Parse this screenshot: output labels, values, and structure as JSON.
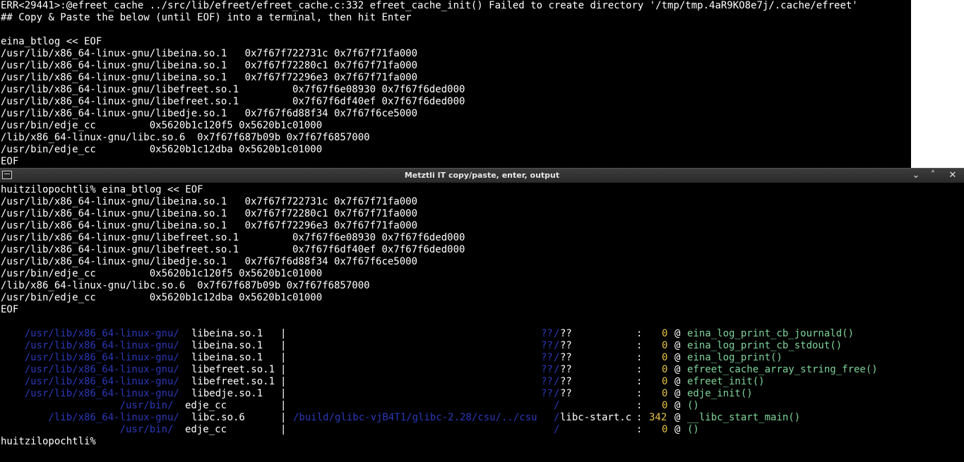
{
  "background_terminal": {
    "lines": [
      "ERR<29441>:@efreet_cache ../src/lib/efreet/efreet_cache.c:332 efreet_cache_init() Failed to create directory '/tmp/tmp.4aR9KO8e7j/.cache/efreet'",
      "## Copy & Paste the below (until EOF) into a terminal, then hit Enter",
      "",
      "eina_btlog << EOF",
      "/usr/lib/x86_64-linux-gnu/libeina.so.1   0x7f67f722731c 0x7f67f71fa000",
      "/usr/lib/x86_64-linux-gnu/libeina.so.1   0x7f67f72280c1 0x7f67f71fa000",
      "/usr/lib/x86_64-linux-gnu/libeina.so.1   0x7f67f72296e3 0x7f67f71fa000",
      "/usr/lib/x86_64-linux-gnu/libefreet.so.1         0x7f67f6e08930 0x7f67f6ded000",
      "/usr/lib/x86_64-linux-gnu/libefreet.so.1         0x7f67f6df40ef 0x7f67f6ded000",
      "/usr/lib/x86_64-linux-gnu/libedje.so.1   0x7f67f6d88f34 0x7f67f6ce5000",
      "/usr/bin/edje_cc         0x5620b1c120f5 0x5620b1c01000",
      "/lib/x86_64-linux-gnu/libc.so.6  0x7f67f687b09b 0x7f67f6857000",
      "/usr/bin/edje_cc         0x5620b1c12dba 0x5620b1c01000",
      "EOF"
    ]
  },
  "window": {
    "title": "Metztli IT copy/paste, enter, output",
    "minimize_glyph": "⌄",
    "maximize_glyph": "˄",
    "close_glyph": "✕"
  },
  "foreground_terminal": {
    "lines": [
      "huitzilopochtli% eina_btlog << EOF",
      "/usr/lib/x86_64-linux-gnu/libeina.so.1   0x7f67f722731c 0x7f67f71fa000",
      "/usr/lib/x86_64-linux-gnu/libeina.so.1   0x7f67f72280c1 0x7f67f71fa000",
      "/usr/lib/x86_64-linux-gnu/libeina.so.1   0x7f67f72296e3 0x7f67f71fa000",
      "/usr/lib/x86_64-linux-gnu/libefreet.so.1         0x7f67f6e08930 0x7f67f6ded000",
      "/usr/lib/x86_64-linux-gnu/libefreet.so.1         0x7f67f6df40ef 0x7f67f6ded000",
      "/usr/lib/x86_64-linux-gnu/libedje.so.1   0x7f67f6d88f34 0x7f67f6ce5000",
      "/usr/bin/edje_cc         0x5620b1c120f5 0x5620b1c01000",
      "/lib/x86_64-linux-gnu/libc.so.6  0x7f67f687b09b 0x7f67f6857000",
      "/usr/bin/edje_cc         0x5620b1c12dba 0x5620b1c01000",
      "EOF"
    ],
    "btlog": [
      {
        "dir": "    /usr/lib/x86_64-linux-gnu/",
        "lib": "libeina.so.1  ",
        "src_dir": "??",
        "src_sep": "/",
        "src_file": "??",
        "line": "0",
        "func": "eina_log_print_cb_journald()"
      },
      {
        "dir": "    /usr/lib/x86_64-linux-gnu/",
        "lib": "libeina.so.1  ",
        "src_dir": "??",
        "src_sep": "/",
        "src_file": "??",
        "line": "0",
        "func": "eina_log_print_cb_stdout()"
      },
      {
        "dir": "    /usr/lib/x86_64-linux-gnu/",
        "lib": "libeina.so.1  ",
        "src_dir": "??",
        "src_sep": "/",
        "src_file": "??",
        "line": "0",
        "func": "eina_log_print()"
      },
      {
        "dir": "    /usr/lib/x86_64-linux-gnu/",
        "lib": "libefreet.so.1",
        "src_dir": "??",
        "src_sep": "/",
        "src_file": "??",
        "line": "0",
        "func": "efreet_cache_array_string_free()"
      },
      {
        "dir": "    /usr/lib/x86_64-linux-gnu/",
        "lib": "libefreet.so.1",
        "src_dir": "??",
        "src_sep": "/",
        "src_file": "??",
        "line": "0",
        "func": "efreet_init()"
      },
      {
        "dir": "    /usr/lib/x86_64-linux-gnu/",
        "lib": "libedje.so.1  ",
        "src_dir": "??",
        "src_sep": "/",
        "src_file": "??",
        "line": "0",
        "func": "edje_init()"
      },
      {
        "dir": "                    /usr/bin/",
        "lib": "edje_cc       ",
        "src_dir": "",
        "src_sep": "/",
        "src_file": "",
        "line": "0",
        "func": "()"
      },
      {
        "dir": "        /lib/x86_64-linux-gnu/",
        "lib": "libc.so.6     ",
        "src_dir": "/build/glibc-vjB4T1/glibc-2.28/csu/../csu",
        "src_sep": "/",
        "src_file": "libc-start.c",
        "line": "342",
        "func": "__libc_start_main()"
      },
      {
        "dir": "                    /usr/bin/",
        "lib": "edje_cc       ",
        "src_dir": "",
        "src_sep": "/",
        "src_file": "",
        "line": "0",
        "func": "()"
      }
    ],
    "prompt": "huitzilopochtli%"
  }
}
